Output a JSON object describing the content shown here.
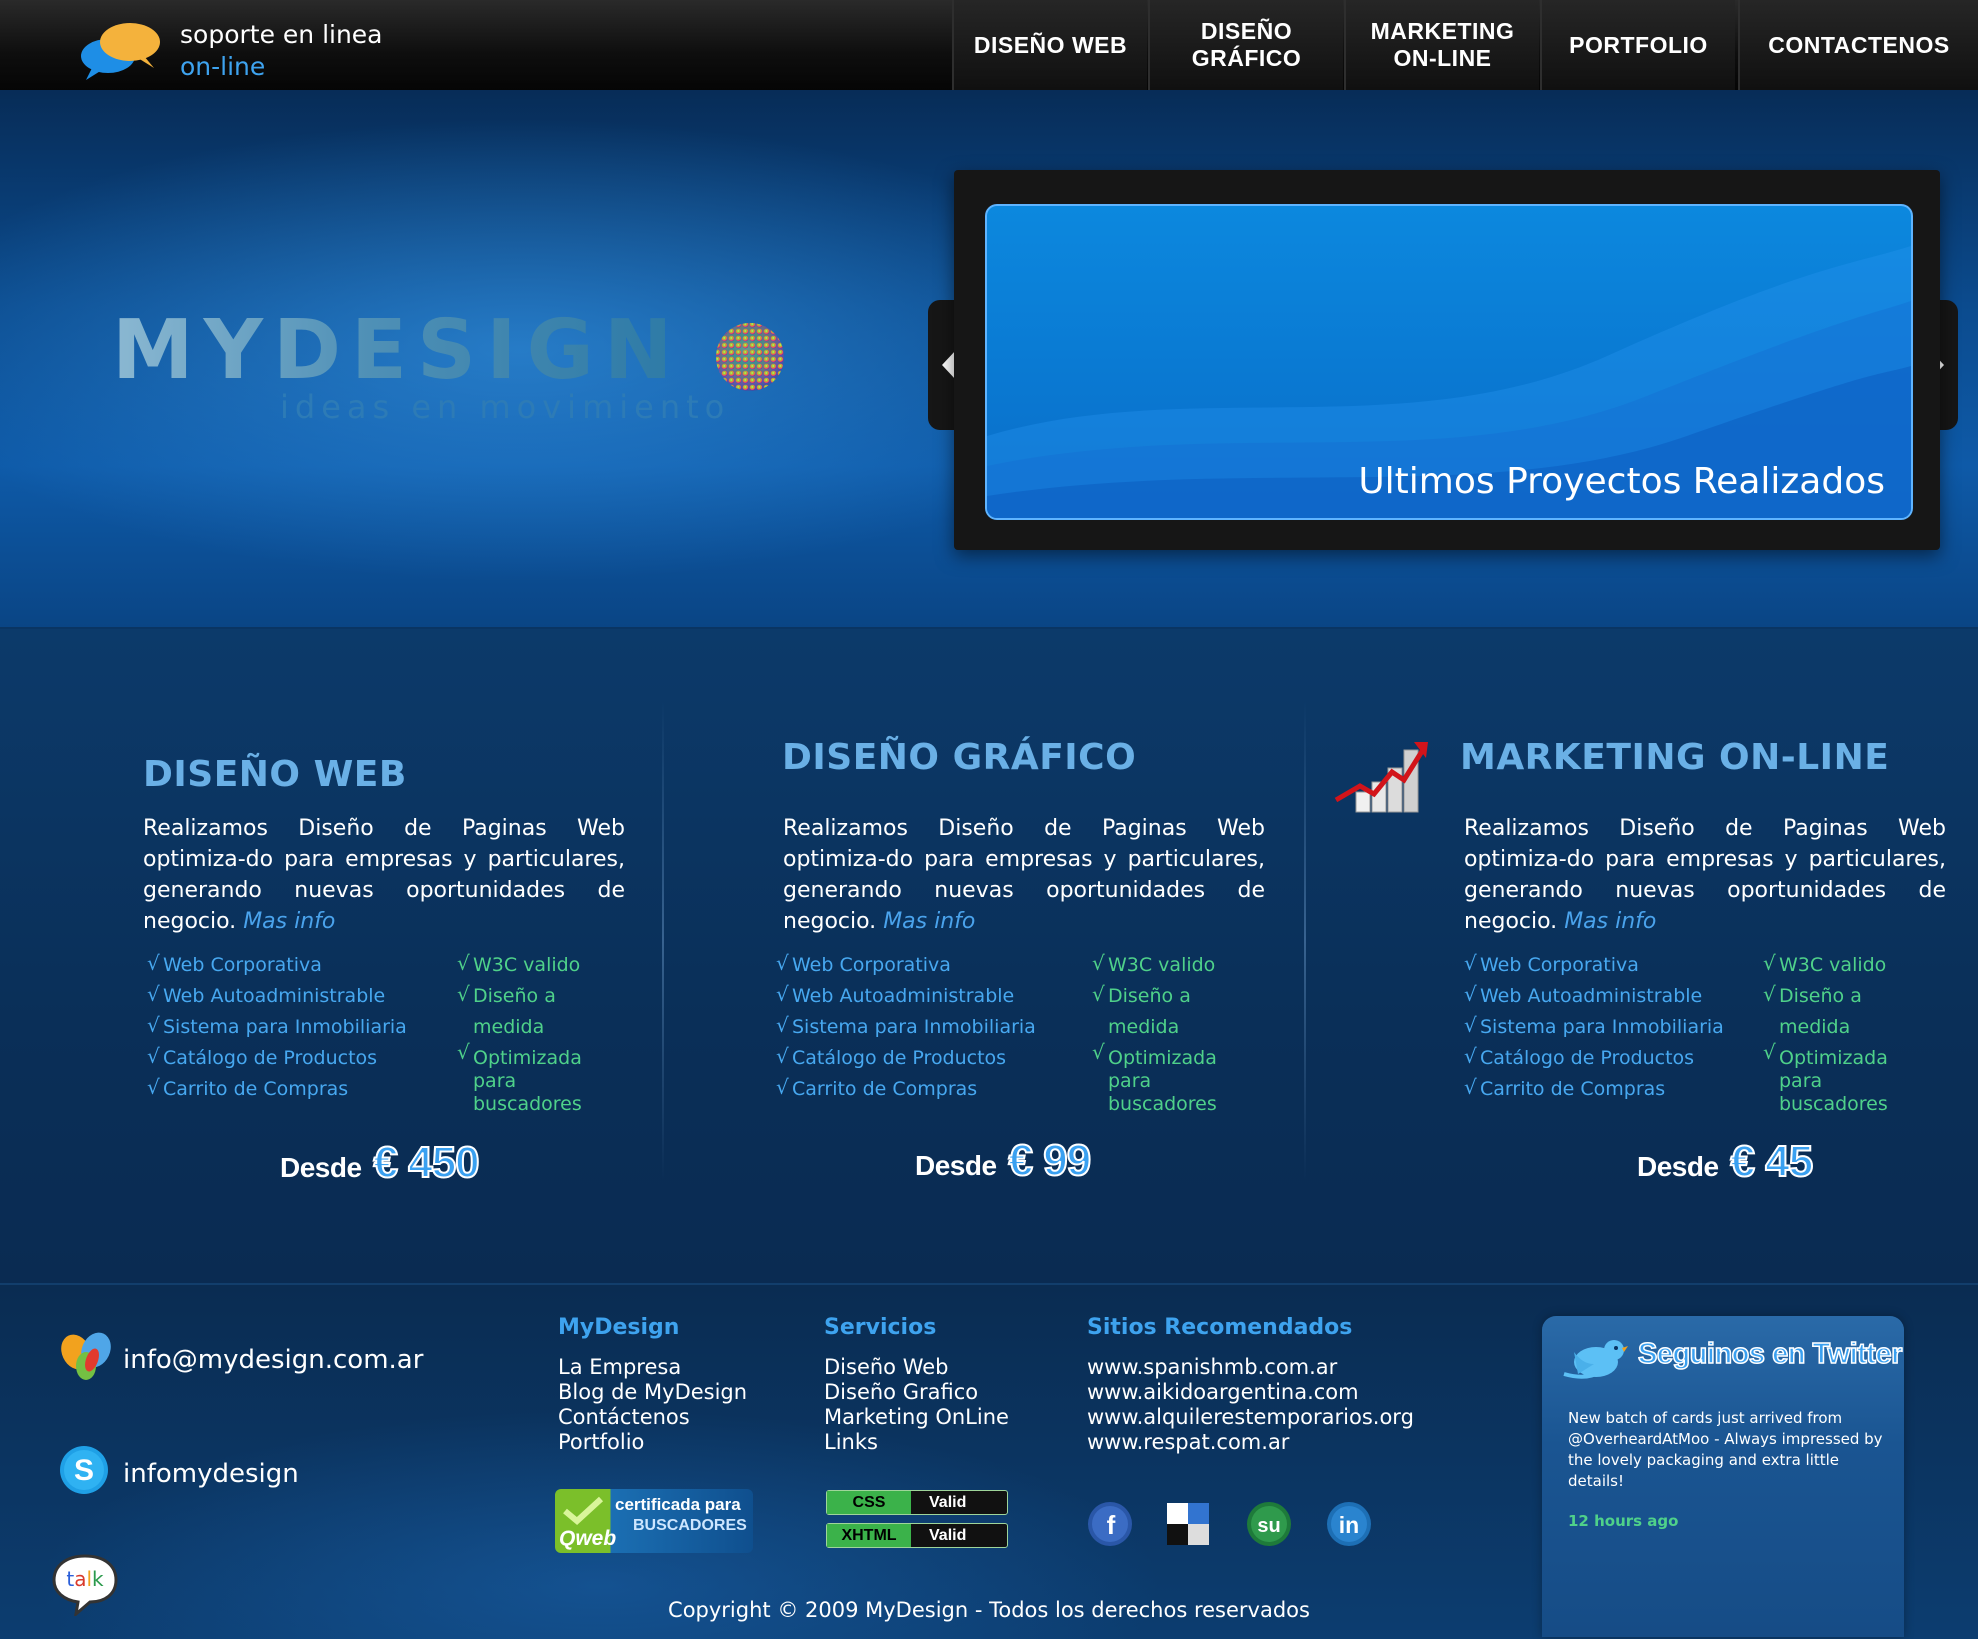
{
  "support": {
    "line1": "soporte en linea",
    "line2": "on-line"
  },
  "nav": [
    {
      "label": "DISEÑO WEB"
    },
    {
      "label": "DISEÑO\nGRÁFICO"
    },
    {
      "label": "MARKETING\nON-LINE"
    },
    {
      "label": "PORTFOLIO"
    },
    {
      "label": "CONTACTENOS"
    }
  ],
  "logo": {
    "name": "MYDESIGN",
    "tagline": "ideas en movimiento"
  },
  "slider": {
    "caption": "Ultimos Proyectos Realizados"
  },
  "services": [
    {
      "title": "DISEÑO WEB",
      "desc": "Realizamos Diseño de Paginas Web optimiza-do para empresas y particulares, generando nuevas oportunidades de negocio.",
      "more": "Mas info",
      "features": [
        "Web Corporativa",
        "Web Autoadministrable",
        "Sistema para Inmobiliaria",
        "Catálogo de Productos",
        "Carrito de Compras"
      ],
      "extras": [
        "W3C valido",
        "Diseño a medida",
        "Optimizada para buscadores"
      ],
      "price_label": "Desde",
      "price": "€ 450"
    },
    {
      "title": "DISEÑO GRÁFICO",
      "desc": "Realizamos Diseño de Paginas Web optimiza-do para empresas y particulares, generando nuevas oportunidades de negocio.",
      "more": "Mas info",
      "features": [
        "Web Corporativa",
        "Web Autoadministrable",
        "Sistema para Inmobiliaria",
        "Catálogo de Productos",
        "Carrito de Compras"
      ],
      "extras": [
        "W3C valido",
        "Diseño a medida",
        "Optimizada para buscadores"
      ],
      "price_label": "Desde",
      "price": "€ 99"
    },
    {
      "title": "MARKETING ON-LINE",
      "desc": "Realizamos Diseño de Paginas Web optimiza-do para empresas y particulares, generando nuevas oportunidades de negocio.",
      "more": "Mas info",
      "features": [
        "Web Corporativa",
        "Web Autoadministrable",
        "Sistema para Inmobiliaria",
        "Catálogo de Productos",
        "Carrito de Compras"
      ],
      "extras": [
        "W3C valido",
        "Diseño a medida",
        "Optimizada para buscadores"
      ],
      "price_label": "Desde",
      "price": "€ 45"
    }
  ],
  "footer": {
    "email": "info@mydesign.com.ar",
    "skype": "infomydesign",
    "col_mydesign": {
      "title": "MyDesign",
      "links": [
        "La Empresa",
        "Blog de MyDesign",
        "Contáctenos",
        "Portfolio"
      ]
    },
    "col_servicios": {
      "title": "Servicios",
      "links": [
        "Diseño Web",
        "Diseño Grafico",
        "Marketing OnLine",
        "Links"
      ]
    },
    "col_sitios": {
      "title": "Sitios Recomendados",
      "links": [
        "www.spanishmb.com.ar",
        "www.aikidoargentina.com",
        "www.alquilerestemporarios.org",
        "www.respat.com.ar"
      ]
    },
    "seo_badge": {
      "line1": "certificada para",
      "line2": "BUSCADORES",
      "brand": "Qweb"
    },
    "css_badge": {
      "left": "CSS",
      "right": "Valid"
    },
    "xhtml_badge": {
      "left": "XHTML",
      "right": "Valid"
    },
    "talk_icon_text": "talk",
    "copyright": "Copyright © 2009 MyDesign - Todos los derechos reservados"
  },
  "twitter": {
    "title": "Seguinos en Twitter",
    "tweet": "New batch of cards just arrived from @OverheardAtMoo - Always impressed by the lovely packaging and extra little details!",
    "time": "12 hours ago"
  },
  "colors": {
    "accent_blue": "#3ea3ef",
    "accent_green": "#4fd18a",
    "nav_bg": "#111111"
  }
}
